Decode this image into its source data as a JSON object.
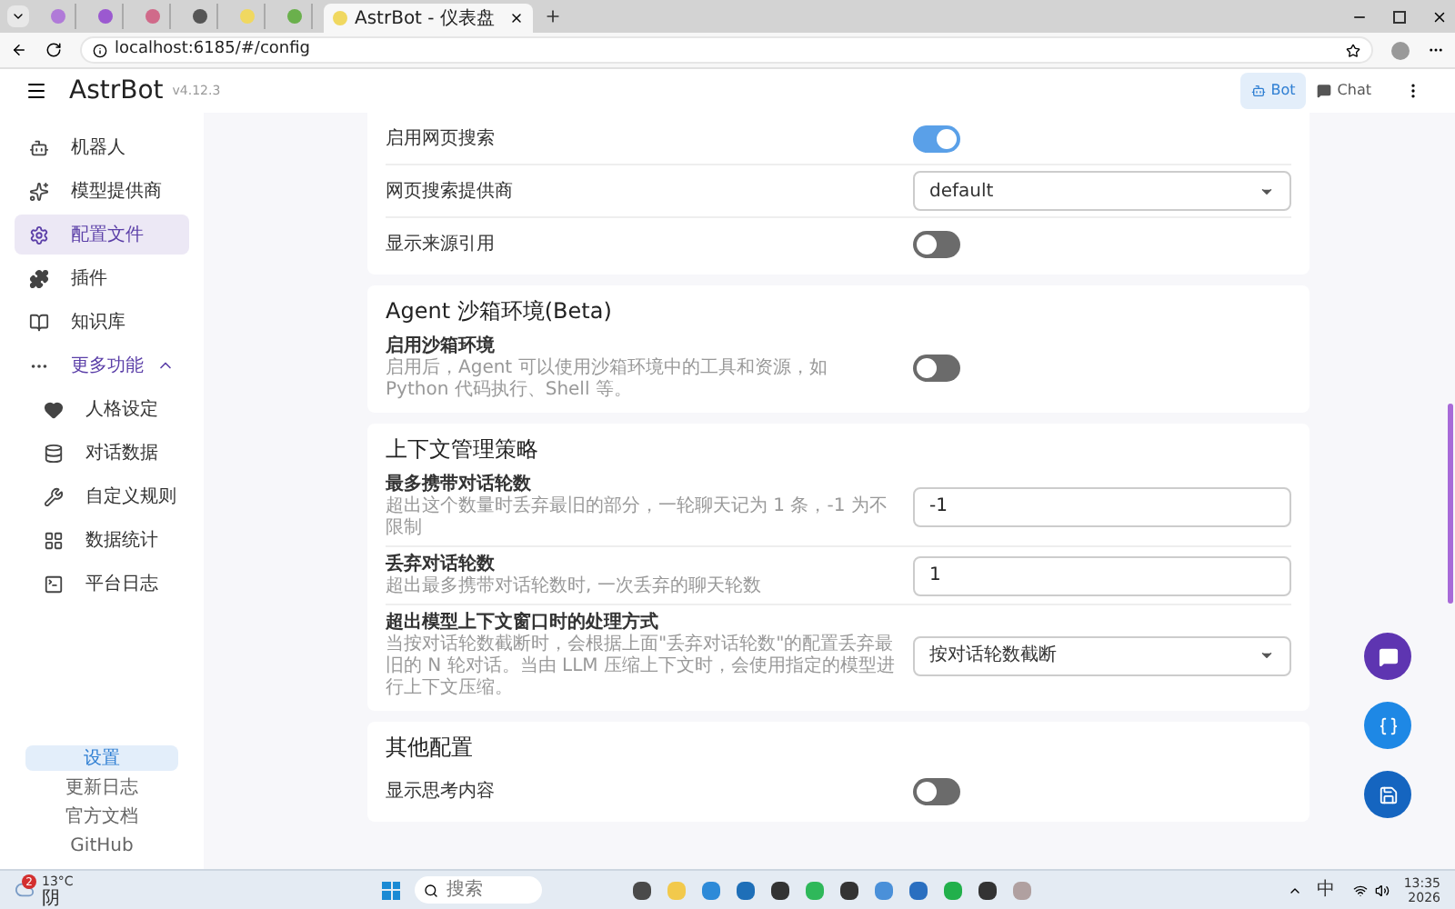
{
  "browser": {
    "tabs": [
      {
        "selected": false,
        "color": "#b07ad8"
      },
      {
        "selected": false,
        "color": "#9b59d0"
      },
      {
        "selected": false,
        "color": "#d06a8a"
      },
      {
        "selected": false,
        "color": "#555555"
      },
      {
        "selected": false,
        "color": "#f0d860"
      },
      {
        "selected": false,
        "color": "#6ab04c"
      },
      {
        "title": "AstrBot - 仪表盘",
        "selected": true,
        "color": "#f0d860"
      }
    ],
    "url": "localhost:6185/#/config"
  },
  "app": {
    "name": "AstrBot",
    "version": "v4.12.3",
    "modes": [
      {
        "label": "Bot",
        "selected": true
      },
      {
        "label": "Chat",
        "selected": false
      }
    ]
  },
  "sidebar": {
    "items": [
      {
        "label": "机器人",
        "selected": false
      },
      {
        "label": "模型提供商",
        "selected": false
      },
      {
        "label": "配置文件",
        "selected": true
      },
      {
        "label": "插件",
        "selected": false
      },
      {
        "label": "知识库",
        "selected": false
      },
      {
        "label": "更多功能",
        "expanded": true,
        "children": [
          {
            "label": "人格设定",
            "selected": false
          },
          {
            "label": "对话数据",
            "selected": false
          },
          {
            "label": "自定义规则",
            "selected": false
          },
          {
            "label": "数据统计",
            "selected": false
          },
          {
            "label": "平台日志",
            "selected": false
          }
        ]
      }
    ],
    "footer": [
      {
        "label": "设置",
        "selected": true
      },
      {
        "label": "更新日志",
        "selected": false
      },
      {
        "label": "官方文档",
        "selected": false
      },
      {
        "label": "GitHub",
        "selected": false
      }
    ]
  },
  "sections": [
    {
      "rows": [
        {
          "kind": "toggle",
          "label": "启用网页搜索",
          "on": true
        },
        {
          "kind": "select",
          "label": "网页搜索提供商",
          "value": "default"
        },
        {
          "kind": "toggle",
          "label": "显示来源引用",
          "on": false
        }
      ]
    },
    {
      "title": "Agent 沙箱环境(Beta)",
      "rows": [
        {
          "kind": "toggle",
          "label": "启用沙箱环境",
          "description": "启用后，Agent 可以使用沙箱环境中的工具和资源，如 Python 代码执行、Shell 等。",
          "on": false
        }
      ]
    },
    {
      "title": "上下文管理策略",
      "rows": [
        {
          "kind": "input",
          "label": "最多携带对话轮数",
          "description": "超出这个数量时丢弃最旧的部分，一轮聊天记为 1 条，-1 为不限制",
          "value": "-1"
        },
        {
          "kind": "input",
          "label": "丢弃对话轮数",
          "description": "超出最多携带对话轮数时, 一次丢弃的聊天轮数",
          "value": "1"
        },
        {
          "kind": "select",
          "label": "超出模型上下文窗口时的处理方式",
          "description": "当按对话轮数截断时，会根据上面\"丢弃对话轮数\"的配置丢弃最旧的 N 轮对话。当由 LLM 压缩上下文时，会使用指定的模型进行上下文压缩。",
          "value": "按对话轮数截断"
        }
      ]
    },
    {
      "title": "其他配置",
      "rows": [
        {
          "kind": "toggle",
          "label": "显示思考内容",
          "on": false
        }
      ]
    }
  ],
  "taskbar": {
    "weather": {
      "temp": "13°C",
      "condition": "阴",
      "badge": "2"
    },
    "search": {
      "placeholder": "搜索"
    },
    "ime": "中",
    "time": "13:35",
    "date": "2026"
  }
}
